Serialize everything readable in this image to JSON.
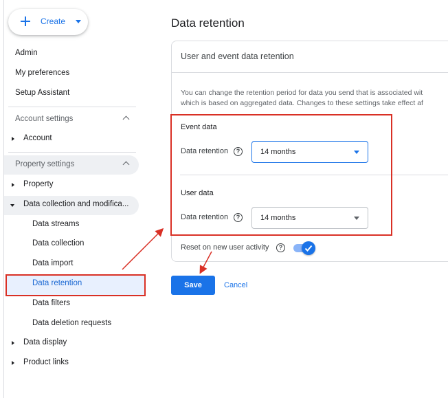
{
  "sidebar": {
    "create_label": "Create",
    "top_items": [
      "Admin",
      "My preferences",
      "Setup Assistant"
    ],
    "account_settings": {
      "label": "Account settings",
      "items": [
        "Account"
      ]
    },
    "property_settings": {
      "label": "Property settings",
      "property": "Property",
      "data_collection": {
        "label": "Data collection and modifica...",
        "children": [
          "Data streams",
          "Data collection",
          "Data import",
          "Data retention",
          "Data filters",
          "Data deletion requests"
        ]
      },
      "data_display": "Data display",
      "product_links": "Product links"
    }
  },
  "main": {
    "title": "Data retention",
    "card": {
      "title": "User and event data retention",
      "description_line1": "You can change the retention period for data you send that is associated wit",
      "description_line2": "which is based on aggregated data. Changes to these settings take effect af",
      "event_data": {
        "heading": "Event data",
        "field_label": "Data retention",
        "value": "14 months"
      },
      "user_data": {
        "heading": "User data",
        "field_label": "Data retention",
        "value": "14 months"
      },
      "reset": {
        "label": "Reset on new user activity",
        "enabled": true
      }
    },
    "save_label": "Save",
    "cancel_label": "Cancel"
  },
  "colors": {
    "accent": "#1a73e8",
    "annotation": "#d93025"
  }
}
